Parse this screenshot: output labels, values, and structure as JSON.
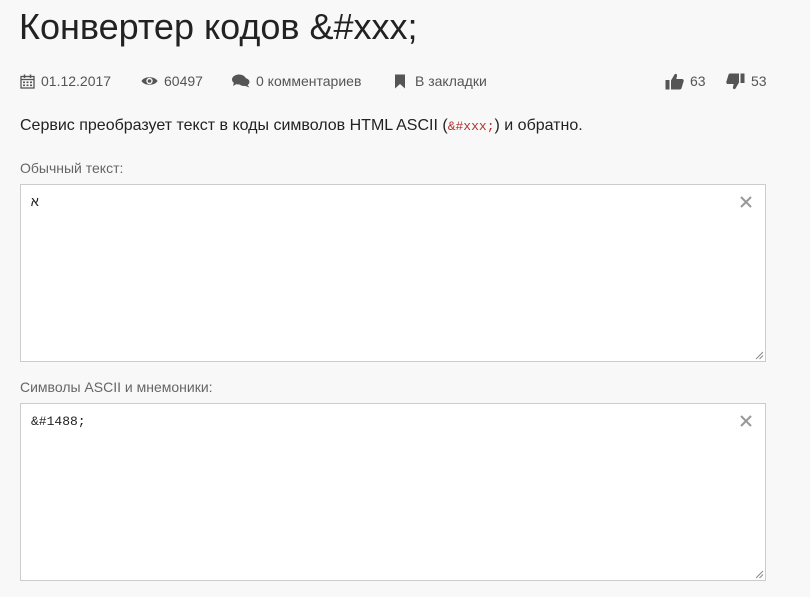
{
  "page": {
    "title": "Конвертер кодов &#xxx;"
  },
  "meta": {
    "date": "01.12.2017",
    "views": "60497",
    "comments": "0 комментариев",
    "bookmark": "В закладки",
    "likes": "63",
    "dislikes": "53"
  },
  "description": {
    "before": "Сервис преобразует текст в коды символов HTML ASCII (",
    "code": "&#xxx;",
    "after": ") и обратно."
  },
  "plain_text": {
    "label": "Обычный текст:",
    "value": "א"
  },
  "ascii_text": {
    "label": "Символы ASCII и мнемоники:",
    "value": "&#1488;"
  },
  "icons": {
    "date": "calendar-icon",
    "views": "eye-icon",
    "comments": "comments-icon",
    "bookmark": "bookmark-icon",
    "likes": "thumbs-up-icon",
    "dislikes": "thumbs-down-icon",
    "clear": "close-icon"
  },
  "colors": {
    "background": "#f8f8f8",
    "icon": "#555555",
    "code": "#b03030"
  }
}
